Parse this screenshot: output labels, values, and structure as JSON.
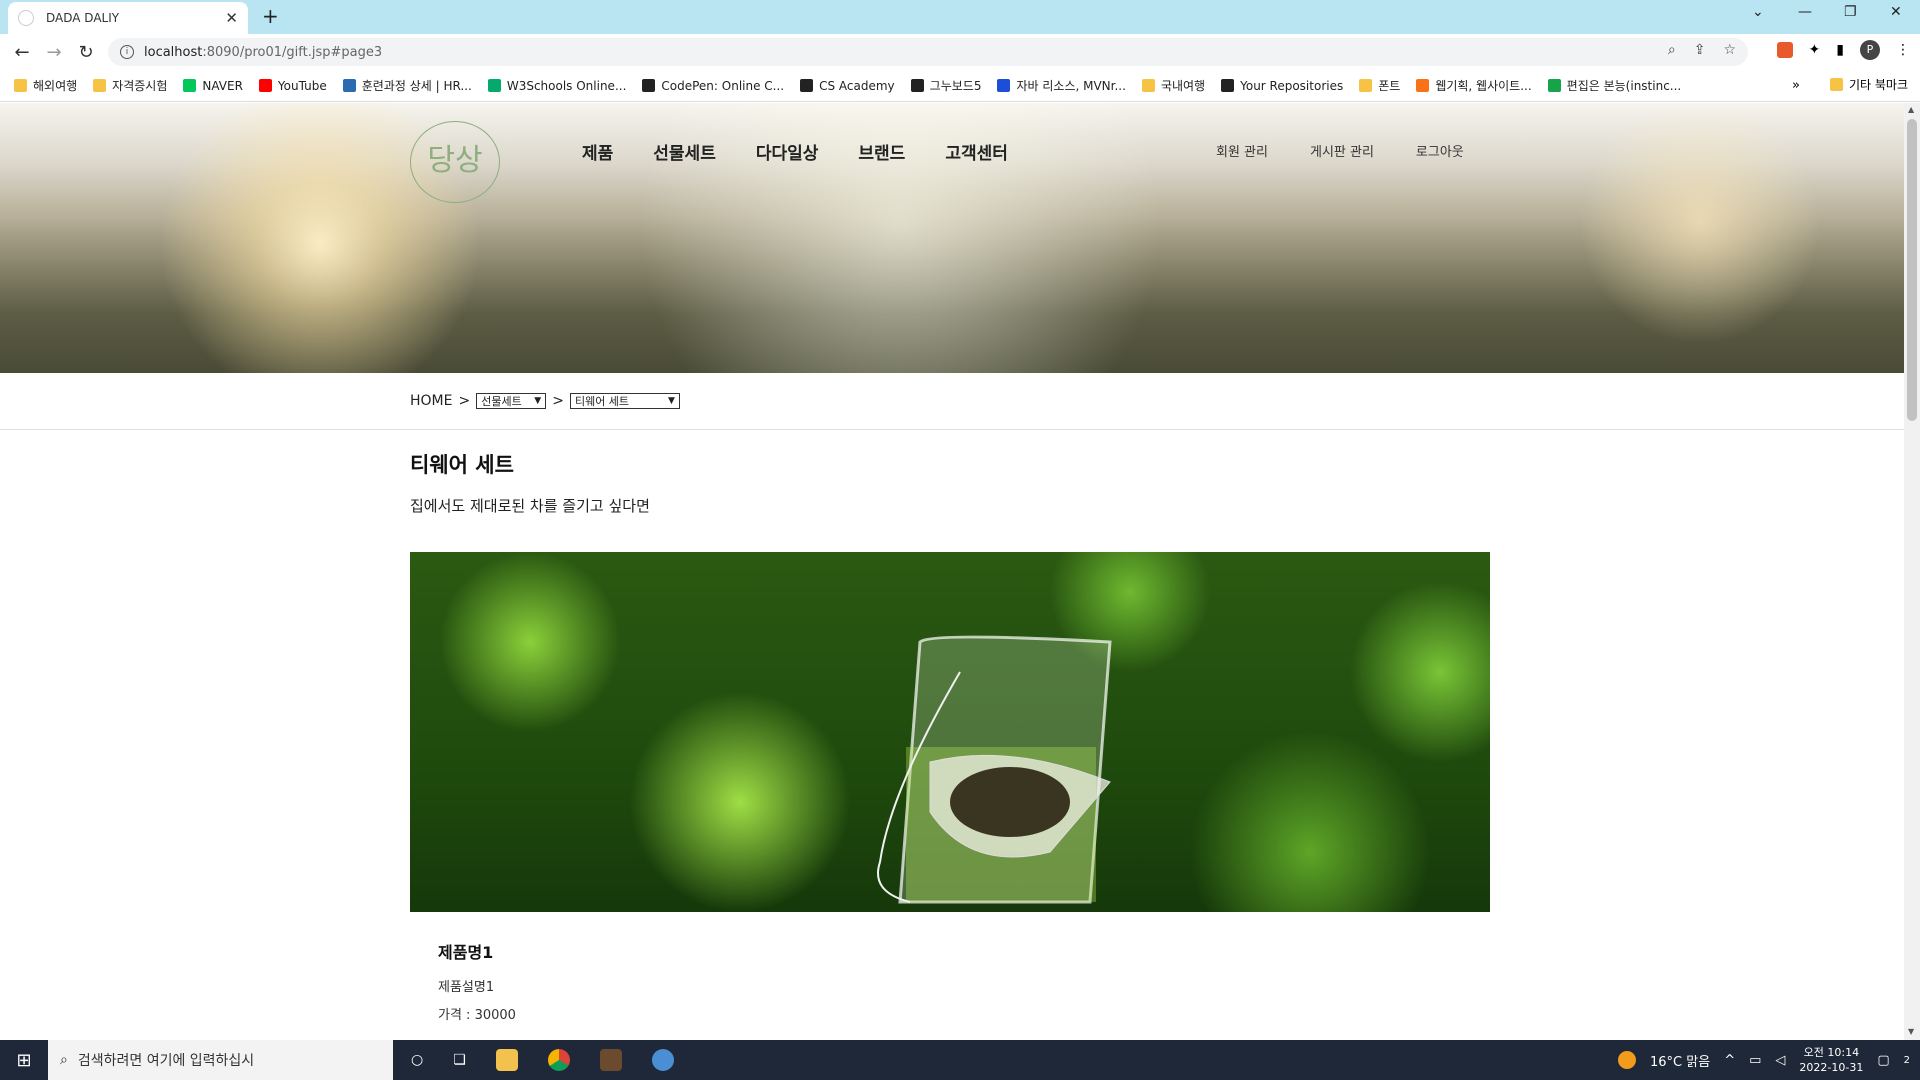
{
  "browser": {
    "tab_title": "DADA DALIY",
    "url_host": "localhost",
    "url_rest": ":8090/pro01/gift.jsp#page3",
    "bookmarks": [
      {
        "label": "해외여행",
        "color": "#f6c344"
      },
      {
        "label": "자격증시험",
        "color": "#f6c344"
      },
      {
        "label": "NAVER",
        "color": "#03c75a"
      },
      {
        "label": "YouTube",
        "color": "#ff0000"
      },
      {
        "label": "훈련과정 상세 | HR...",
        "color": "#2b6cb0"
      },
      {
        "label": "W3Schools Online...",
        "color": "#04aa6d"
      },
      {
        "label": "CodePen: Online C...",
        "color": "#222222"
      },
      {
        "label": "CS Academy",
        "color": "#222222"
      },
      {
        "label": "그누보드5",
        "color": "#222222"
      },
      {
        "label": "자바 리소스, MVNr...",
        "color": "#1d4ed8"
      },
      {
        "label": "국내여행",
        "color": "#f6c344"
      },
      {
        "label": "Your Repositories",
        "color": "#222222"
      },
      {
        "label": "폰트",
        "color": "#f6c344"
      },
      {
        "label": "웹기획, 웹사이트...",
        "color": "#f97316"
      },
      {
        "label": "편집은 본능(instinc...",
        "color": "#16a34a"
      }
    ],
    "bookmarks_more": "»",
    "other_bookmarks": "기타 북마크",
    "profile_initial": "P"
  },
  "site": {
    "logo_text": "당상",
    "gnb": [
      "제품",
      "선물세트",
      "다다일상",
      "브랜드",
      "고객센터"
    ],
    "util": [
      "회원 관리",
      "게시판 관리",
      "로그아웃"
    ],
    "breadcrumb": {
      "home": "HOME",
      "sep": ">",
      "select1": "선물세트",
      "select2": "티웨어 세트"
    },
    "page_title": "티웨어 세트",
    "page_subtitle": "집에서도 제대로된 차를 즐기고 싶다면",
    "product": {
      "name": "제품명1",
      "desc": "제품설명1",
      "price": "가격 : 30000"
    }
  },
  "taskbar": {
    "search_placeholder": "검색하려면 여기에 입력하십시",
    "weather": "16°C  맑음",
    "time": "오전 10:14",
    "date": "2022-10-31",
    "notif_count": "2"
  }
}
